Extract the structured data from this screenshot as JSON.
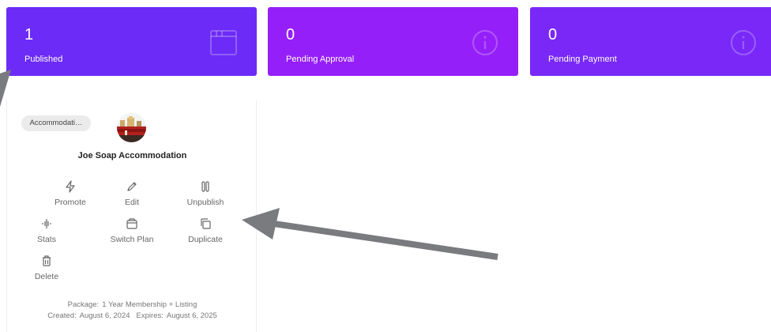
{
  "stats": [
    {
      "value": "1",
      "label": "Published",
      "icon": "browser-window-icon",
      "color": "#6c2bf7"
    },
    {
      "value": "0",
      "label": "Pending Approval",
      "icon": "info-circle-icon",
      "color": "#951ff9"
    },
    {
      "value": "0",
      "label": "Pending Payment",
      "icon": "info-circle-icon",
      "color": "#7928f8"
    }
  ],
  "listing": {
    "category": "Accommodati…",
    "title": "Joe Soap Accommodation",
    "actions": [
      {
        "label": "Promote",
        "icon": "lightning-icon"
      },
      {
        "label": "Edit",
        "icon": "pencil-icon"
      },
      {
        "label": "Unpublish",
        "icon": "pause-icon"
      },
      {
        "label": "Stats",
        "icon": "waveform-icon"
      },
      {
        "label": "Switch Plan",
        "icon": "package-box-icon"
      },
      {
        "label": "Duplicate",
        "icon": "copy-icon"
      },
      {
        "label": "Delete",
        "icon": "trash-icon"
      }
    ],
    "package_label": "Package:",
    "package_value": "1 Year Membership + Listing",
    "created_label": "Created:",
    "created_value": "August 6, 2024",
    "expires_label": "Expires:",
    "expires_value": "August 6, 2025"
  }
}
